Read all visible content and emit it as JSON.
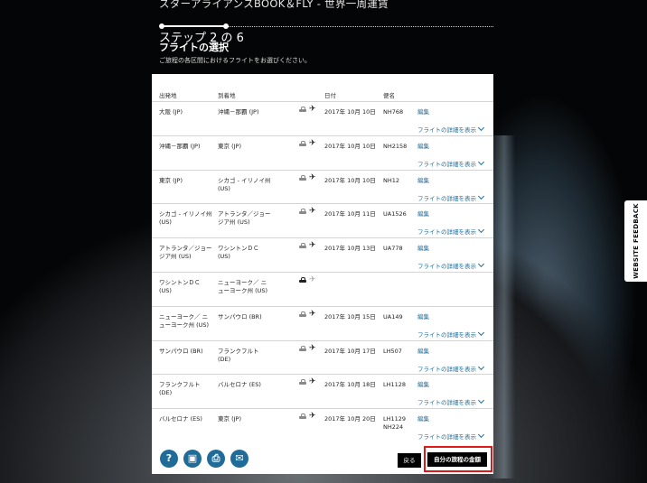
{
  "header": {
    "title": "スターアライアンスBOOK＆FLY - 世界一周運賃",
    "step_label": "ステップ 2 の 6",
    "step_title": "フライトの選択",
    "step_subtitle": "ご旅程の各区間におけるフライトをお選びください。"
  },
  "table": {
    "headers": {
      "from": "出発地",
      "to": "到着地",
      "date": "日付",
      "flight": "便名"
    },
    "rows": [
      {
        "from": "大阪 (JP)",
        "to": "沖縄－那覇 (JP)",
        "date": "2017年 10月 10日",
        "flight": "NH768",
        "edit": "編集",
        "detail": "フライトの詳細を表示",
        "mode": "flight"
      },
      {
        "from": "沖縄－那覇 (JP)",
        "to": "東京 (JP)",
        "date": "2017年 10月 10日",
        "flight": "NH2158",
        "edit": "編集",
        "detail": "フライトの詳細を表示",
        "mode": "flight"
      },
      {
        "from": "東京 (JP)",
        "to": "シカゴ - イリノイ州 (US)",
        "date": "2017年 10月 10日",
        "flight": "NH12",
        "edit": "編集",
        "detail": "フライトの詳細を表示",
        "mode": "flight"
      },
      {
        "from": "シカゴ - イリノイ州 (US)",
        "to": "アトランタ／ジョージア州 (US)",
        "date": "2017年 10月 11日",
        "flight": "UA1526",
        "edit": "編集",
        "detail": "フライトの詳細を表示",
        "mode": "flight"
      },
      {
        "from": "アトランタ／ジョージア州 (US)",
        "to": "ワシントンＤＣ (US)",
        "date": "2017年 10月 13日",
        "flight": "UA778",
        "edit": "編集",
        "detail": "フライトの詳細を表示",
        "mode": "flight"
      },
      {
        "from": "ワシントンＤＣ (US)",
        "to": "ニューヨーク／ ニューヨーク州 (US)",
        "date": "",
        "flight": "",
        "edit": "",
        "detail": "",
        "mode": "surface"
      },
      {
        "from": "ニューヨーク／ ニューヨーク州 (US)",
        "to": "サンパウロ (BR)",
        "date": "2017年 10月 15日",
        "flight": "UA149",
        "edit": "編集",
        "detail": "フライトの詳細を表示",
        "mode": "flight"
      },
      {
        "from": "サンパウロ (BR)",
        "to": "フランクフルト (DE)",
        "date": "2017年 10月 17日",
        "flight": "LH507",
        "edit": "編集",
        "detail": "フライトの詳細を表示",
        "mode": "flight"
      },
      {
        "from": "フランクフルト (DE)",
        "to": "バルセロナ (ES)",
        "date": "2017年 10月 18日",
        "flight": "LH1128",
        "edit": "編集",
        "detail": "フライトの詳細を表示",
        "mode": "flight"
      },
      {
        "from": "バルセロナ (ES)",
        "to": "東京 (JP)",
        "date": "2017年 10月 20日",
        "flight": "LH1129 NH224",
        "edit": "編集",
        "detail": "フライトの詳細を表示",
        "mode": "flight"
      }
    ]
  },
  "footer": {
    "icons": [
      {
        "name": "help-icon",
        "glyph": "?"
      },
      {
        "name": "save-icon",
        "glyph": "▣"
      },
      {
        "name": "print-icon",
        "glyph": "⎙"
      },
      {
        "name": "email-icon",
        "glyph": "✉"
      }
    ],
    "back_label": "戻る",
    "price_label": "自分の旅程の金額"
  },
  "feedback_label": "WEBSITE FEEDBACK",
  "colors": {
    "link": "#1f6c99",
    "highlight": "#e01818"
  }
}
